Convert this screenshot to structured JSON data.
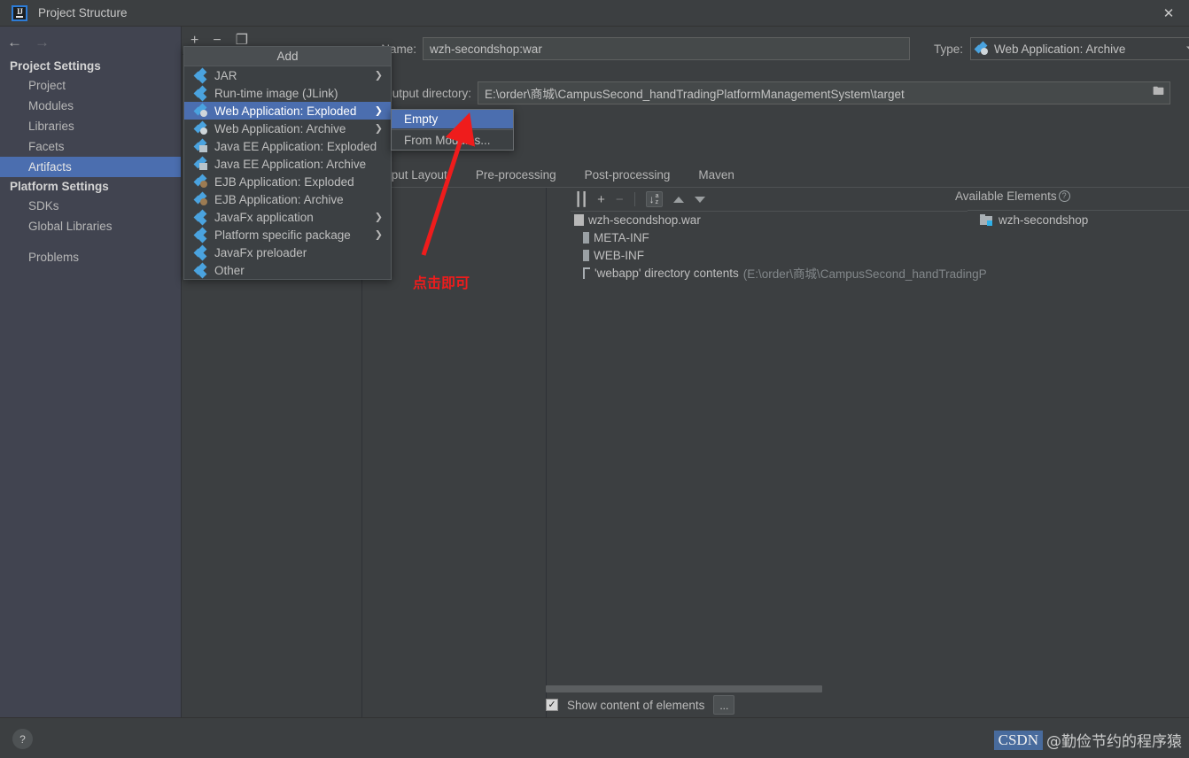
{
  "window": {
    "title": "Project Structure",
    "logo_text": "IJ",
    "close_label": "✕"
  },
  "nav": {
    "back": "←",
    "forward": "→"
  },
  "sidebar": {
    "groups": [
      {
        "label": "Project Settings",
        "items": [
          {
            "label": "Project",
            "selected": false
          },
          {
            "label": "Modules",
            "selected": false
          },
          {
            "label": "Libraries",
            "selected": false
          },
          {
            "label": "Facets",
            "selected": false
          },
          {
            "label": "Artifacts",
            "selected": true
          }
        ]
      },
      {
        "label": "Platform Settings",
        "items": [
          {
            "label": "SDKs",
            "selected": false
          },
          {
            "label": "Global Libraries",
            "selected": false
          }
        ]
      }
    ],
    "extra_items": [
      {
        "label": "Problems",
        "selected": false
      }
    ]
  },
  "toolbar": {
    "add": "+",
    "remove": "−",
    "copy": "❐"
  },
  "add_menu": {
    "title": "Add",
    "items": [
      {
        "label": "JAR",
        "icon": "artifact-jar-icon",
        "submenu": true,
        "selected": false
      },
      {
        "label": "Run-time image (JLink)",
        "icon": "artifact-jlink-icon",
        "submenu": false,
        "selected": false
      },
      {
        "label": "Web Application: Exploded",
        "icon": "web-app-icon",
        "submenu": true,
        "selected": true
      },
      {
        "label": "Web Application: Archive",
        "icon": "web-app-icon",
        "submenu": true,
        "selected": false
      },
      {
        "label": "Java EE Application: Exploded",
        "icon": "java-ee-icon",
        "submenu": false,
        "selected": false
      },
      {
        "label": "Java EE Application: Archive",
        "icon": "java-ee-icon",
        "submenu": false,
        "selected": false
      },
      {
        "label": "EJB Application: Exploded",
        "icon": "ejb-icon",
        "submenu": false,
        "selected": false
      },
      {
        "label": "EJB Application: Archive",
        "icon": "ejb-icon",
        "submenu": false,
        "selected": false
      },
      {
        "label": "JavaFx application",
        "icon": "artifact-jar-icon",
        "submenu": true,
        "selected": false
      },
      {
        "label": "Platform specific package",
        "icon": "artifact-jar-icon",
        "submenu": true,
        "selected": false
      },
      {
        "label": "JavaFx preloader",
        "icon": "artifact-jar-icon",
        "submenu": false,
        "selected": false
      },
      {
        "label": "Other",
        "icon": "artifact-jar-icon",
        "submenu": false,
        "selected": false
      }
    ]
  },
  "sub_menu": {
    "items": [
      {
        "label": "Empty",
        "selected": true
      },
      {
        "label": "From Modules...",
        "selected": false
      }
    ]
  },
  "artifact_form": {
    "name_label": "Name:",
    "name_value": "wzh-secondshop:war",
    "type_label": "Type:",
    "type_value": "Web Application: Archive",
    "output_label": "Output directory:",
    "output_value": "E:\\order\\商城\\CampusSecond_handTradingPlatformManagementSystem\\target",
    "folder_icon": "folder-icon"
  },
  "tabs": [
    {
      "label": "Output Layout",
      "active": true
    },
    {
      "label": "Pre-processing",
      "active": false
    },
    {
      "label": "Post-processing",
      "active": false
    },
    {
      "label": "Maven",
      "active": false
    }
  ],
  "tree_toolbar": {
    "surround": "surround-icon",
    "add": "+",
    "remove": "−",
    "sort": "sort-az-icon",
    "move_up": "arrow-up-icon",
    "move_down": "arrow-down-icon"
  },
  "output_tree": [
    {
      "label": "wzh-secondshop.war",
      "suffix": "",
      "icon": "war-file-icon",
      "indent": 0
    },
    {
      "label": "META-INF",
      "suffix": "",
      "icon": "directory-icon",
      "indent": 1
    },
    {
      "label": "WEB-INF",
      "suffix": "",
      "icon": "directory-icon",
      "indent": 1
    },
    {
      "label": "'webapp' directory contents",
      "suffix": "(E:\\order\\商城\\CampusSecond_handTradingP",
      "icon": "directory-contents-icon",
      "indent": 1
    }
  ],
  "available_elements": {
    "header": "Available Elements",
    "help": "?",
    "items": [
      {
        "label": "wzh-secondshop",
        "icon": "module-icon"
      }
    ]
  },
  "bottom": {
    "show_content_label": "Show content of elements",
    "show_content_checked": true,
    "check_mark": "✓",
    "more_button": "..."
  },
  "footer": {
    "help_button": "?"
  },
  "annotation": {
    "text": "点击即可",
    "color": "#ef1c1c"
  },
  "watermark": {
    "brand": "CSDN",
    "user": "@勤俭节约的程序猿"
  },
  "colors": {
    "background": "#3c3f41",
    "sidebar": "#414450",
    "selection": "#4b6eaf",
    "accent": "#4aa3df",
    "text": "#bbbbbb",
    "annotation": "#ef1c1c"
  }
}
